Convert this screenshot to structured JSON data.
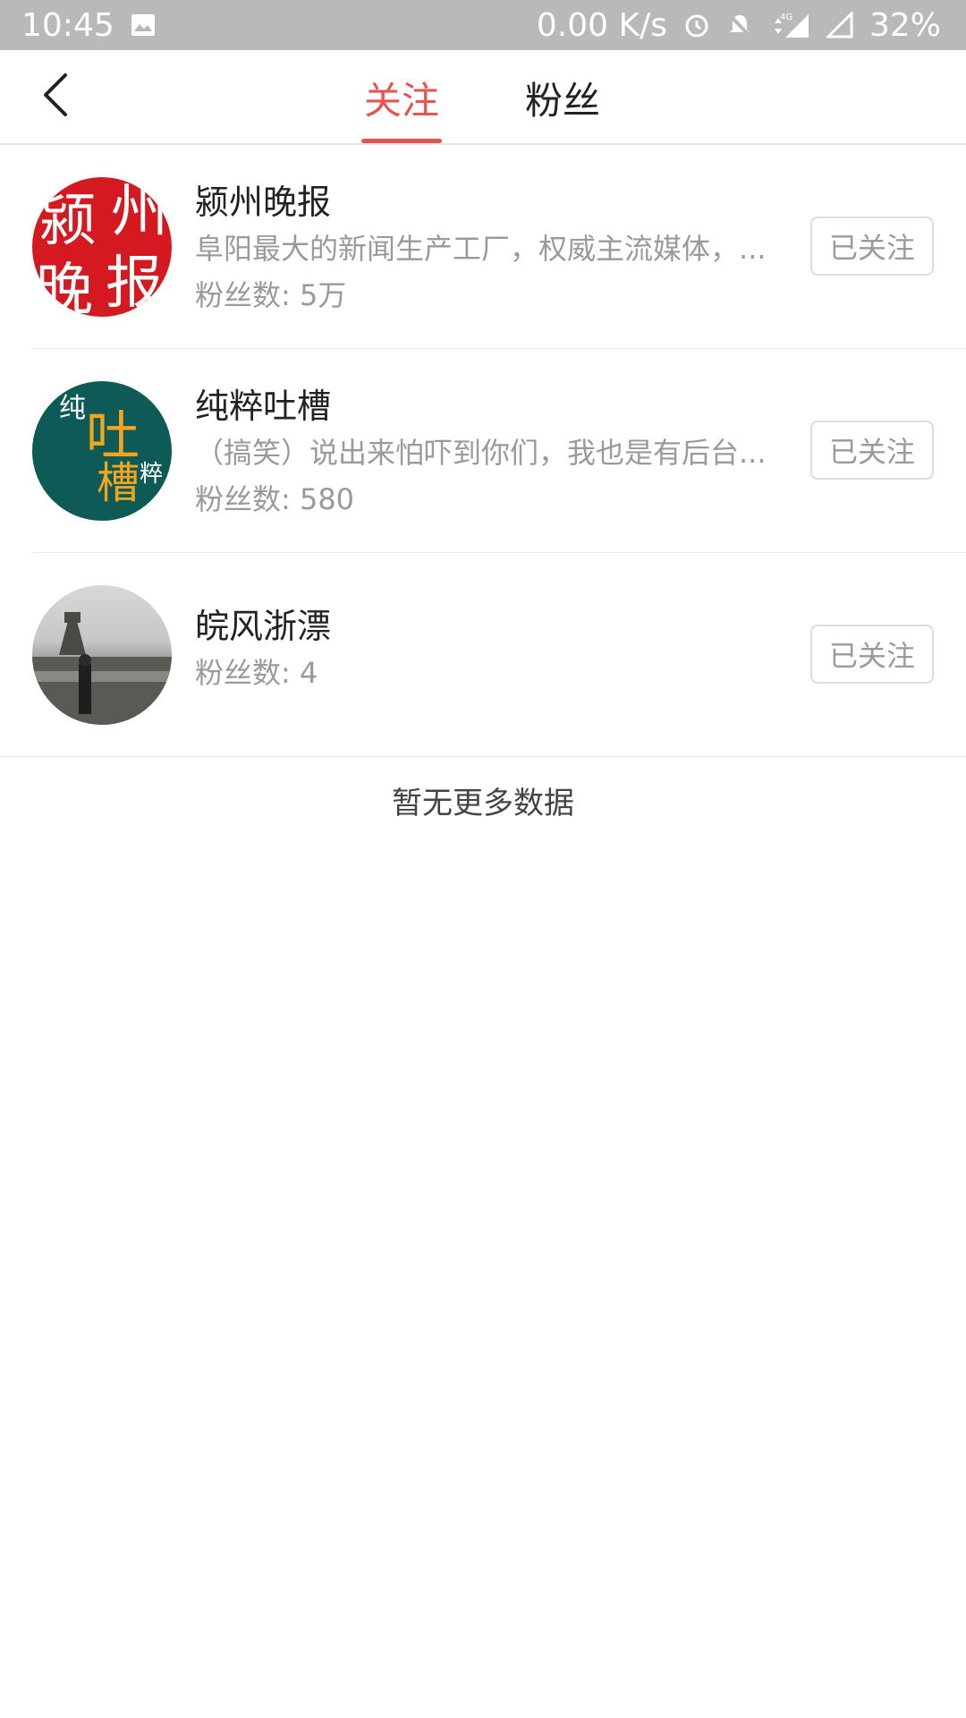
{
  "status_bar": {
    "time": "10:45",
    "speed": "0.00 K/s",
    "battery": "32%",
    "network": "4G",
    "icons": [
      "image-icon",
      "alarm-icon",
      "bell-off-icon",
      "signal-icon",
      "signal-empty-icon"
    ]
  },
  "nav": {
    "back_icon": "chevron-left-icon",
    "tabs": [
      {
        "label": "关注",
        "active": true
      },
      {
        "label": "粉丝",
        "active": false
      }
    ],
    "accent_color": "#e5544e"
  },
  "items": [
    {
      "name": "颍州晚报",
      "desc": "阜阳最大的新闻生产工厂，权威主流媒体，...",
      "fans": "粉丝数: 5万",
      "button": "已关注",
      "avatar_text": [
        "颍",
        "州",
        "晚",
        "报"
      ]
    },
    {
      "name": "纯粹吐槽",
      "desc": "（搞笑）说出来怕吓到你们，我也是有后台...",
      "fans": "粉丝数: 580",
      "button": "已关注",
      "avatar_text": [
        "纯",
        "吐",
        "槽",
        "粹"
      ]
    },
    {
      "name": "皖风浙漂",
      "fans": "粉丝数: 4",
      "button": "已关注"
    }
  ],
  "footer": {
    "no_more": "暂无更多数据"
  }
}
